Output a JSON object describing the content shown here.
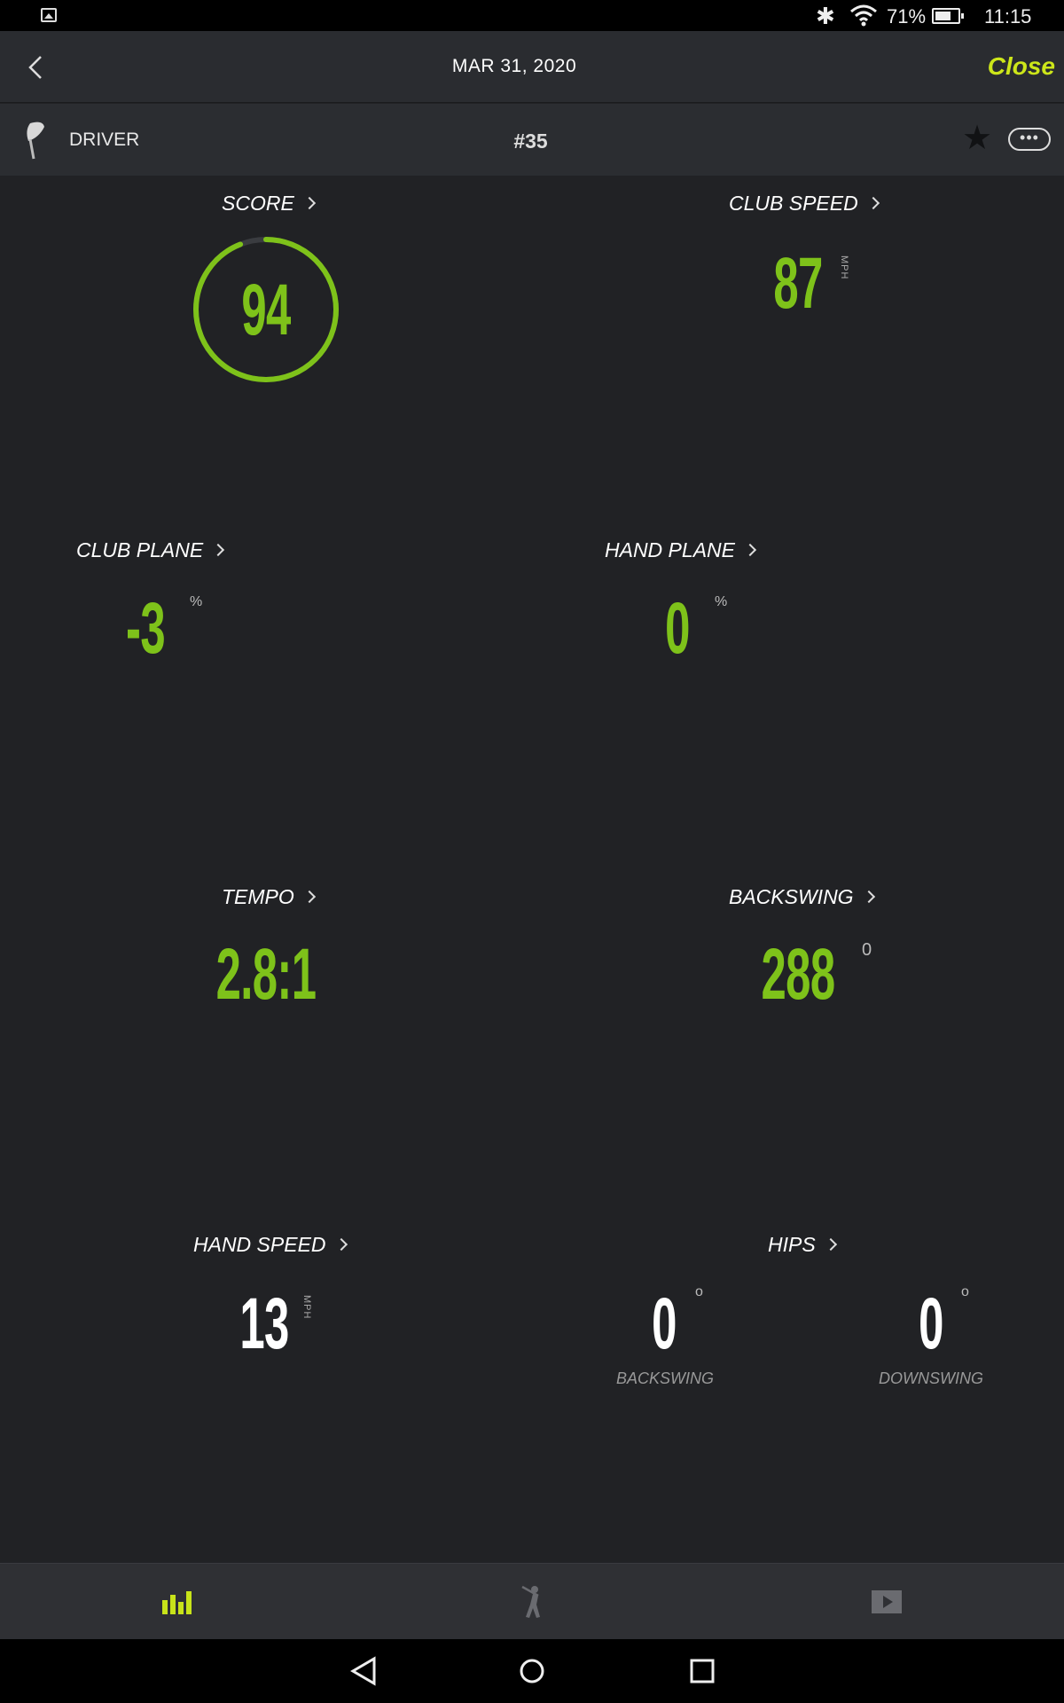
{
  "status_bar": {
    "battery_percent": "71%",
    "battery_level": 0.71,
    "time": "11:15"
  },
  "header": {
    "date": "MAR 31, 2020",
    "close_label": "Close"
  },
  "club_bar": {
    "club": "DRIVER",
    "swing_number": "#35"
  },
  "metrics": {
    "score": {
      "label": "SCORE",
      "value": "94",
      "value_num": 94,
      "max": 100
    },
    "club_speed": {
      "label": "CLUB SPEED",
      "value": "87",
      "unit": "MPH"
    },
    "club_plane": {
      "label": "CLUB PLANE",
      "value": "-3",
      "unit": "%"
    },
    "hand_plane": {
      "label": "HAND PLANE",
      "value": "0",
      "unit": "%"
    },
    "tempo": {
      "label": "TEMPO",
      "value": "2.8:1"
    },
    "backswing": {
      "label": "BACKSWING",
      "value": "288",
      "unit": "0"
    },
    "hand_speed": {
      "label": "HAND SPEED",
      "value": "13",
      "unit": "MPH"
    },
    "hips": {
      "label": "HIPS",
      "backswing_value": "0",
      "backswing_unit": "o",
      "backswing_label": "BACKSWING",
      "downswing_value": "0",
      "downswing_unit": "o",
      "downswing_label": "DOWNSWING"
    }
  },
  "tabs": [
    "stats-tab",
    "swing-tab",
    "video-tab"
  ],
  "colors": {
    "accent_green": "#7ec21a",
    "close_yellow": "#cde61a",
    "background": "#212225"
  }
}
